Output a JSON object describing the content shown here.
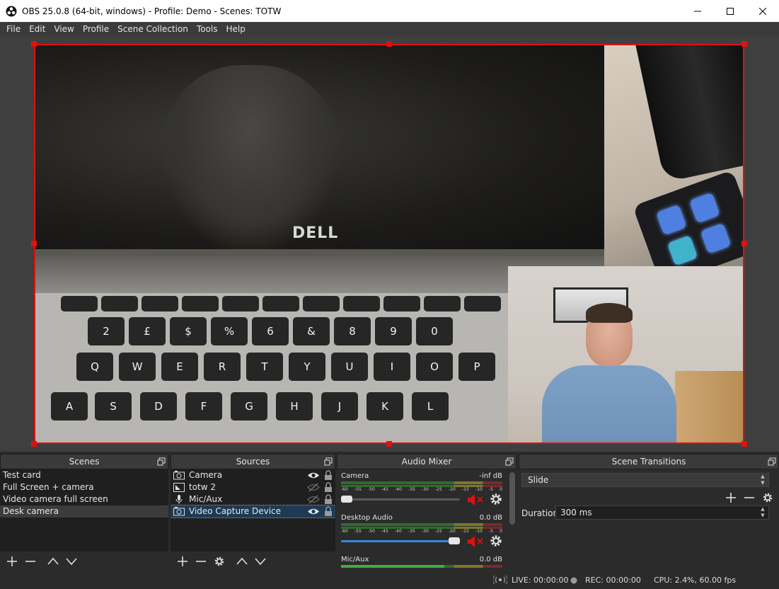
{
  "window": {
    "title": "OBS 25.0.8 (64-bit, windows) - Profile: Demo - Scenes: TOTW"
  },
  "menu": [
    "File",
    "Edit",
    "View",
    "Profile",
    "Scene Collection",
    "Tools",
    "Help"
  ],
  "preview": {
    "laptop_logo": "DELL",
    "keyboard_keys": [
      "Q",
      "W",
      "E",
      "R",
      "T",
      "Y",
      "U",
      "I",
      "O",
      "P",
      "A",
      "S",
      "D",
      "F",
      "G",
      "H",
      "J",
      "K",
      "L",
      "2",
      "£",
      "$",
      "%",
      "6",
      "&",
      "8",
      "9",
      "0"
    ]
  },
  "scenes": {
    "title": "Scenes",
    "items": [
      "Test card",
      "Full Screen + camera",
      "Video camera full screen",
      "Desk camera"
    ],
    "selected_index": 3
  },
  "sources": {
    "title": "Sources",
    "items": [
      {
        "label": "Camera",
        "icon": "camera-icon",
        "visible": true
      },
      {
        "label": "totw 2",
        "icon": "image-icon",
        "visible": false
      },
      {
        "label": "Mic/Aux",
        "icon": "microphone-icon",
        "visible": false
      },
      {
        "label": "Video Capture Device",
        "icon": "camera-icon",
        "visible": true
      }
    ],
    "selected_index": 3
  },
  "mixer": {
    "title": "Audio Mixer",
    "scale": [
      "-60",
      "-55",
      "-50",
      "-45",
      "-40",
      "-35",
      "-30",
      "-25",
      "-20",
      "-15",
      "-10",
      "-5",
      "0"
    ],
    "channels": [
      {
        "name": "Camera",
        "db": "-inf dB",
        "volume": 0.0,
        "muted": true
      },
      {
        "name": "Desktop Audio",
        "db": "0.0 dB",
        "volume": 1.0,
        "muted": true
      },
      {
        "name": "Mic/Aux",
        "db": "0.0 dB",
        "volume": 1.0,
        "muted": false
      }
    ]
  },
  "transitions": {
    "title": "Scene Transitions",
    "selected": "Slide",
    "duration_label": "Duration",
    "duration_value": "300 ms"
  },
  "status": {
    "live": "LIVE: 00:00:00",
    "rec": "REC: 00:00:00",
    "cpu": "CPU: 2.4%, 60.00 fps"
  },
  "colors": {
    "selection": "#e01010",
    "mute": "#e01010",
    "slider_fill": "#3d86d6"
  }
}
